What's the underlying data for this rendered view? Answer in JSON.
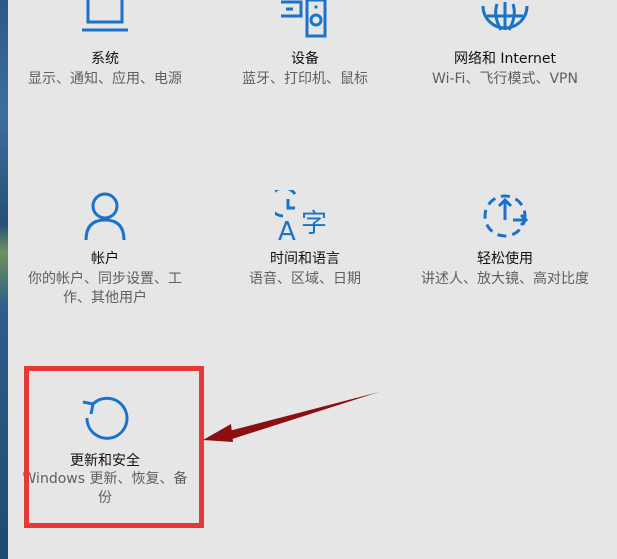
{
  "tiles": [
    {
      "title": "系统",
      "desc": "显示、通知、应用、电源",
      "icon": "laptop-icon"
    },
    {
      "title": "设备",
      "desc": "蓝牙、打印机、鼠标",
      "icon": "devices-icon"
    },
    {
      "title": "网络和 Internet",
      "desc": "Wi-Fi、飞行模式、VPN",
      "icon": "globe-icon"
    },
    {
      "title": "帐户",
      "desc": "你的帐户、同步设置、工作、其他用户",
      "icon": "person-icon"
    },
    {
      "title": "时间和语言",
      "desc": "语音、区域、日期",
      "icon": "time-language-icon"
    },
    {
      "title": "轻松使用",
      "desc": "讲述人、放大镜、高对比度",
      "icon": "ease-of-access-icon"
    },
    {
      "title": "更新和安全",
      "desc": "Windows 更新、恢复、备份",
      "icon": "update-icon"
    }
  ],
  "colors": {
    "accent": "#1a73c8",
    "highlight": "#e53935",
    "arrow": "#8b0f0f",
    "background": "#e6e6e6"
  }
}
